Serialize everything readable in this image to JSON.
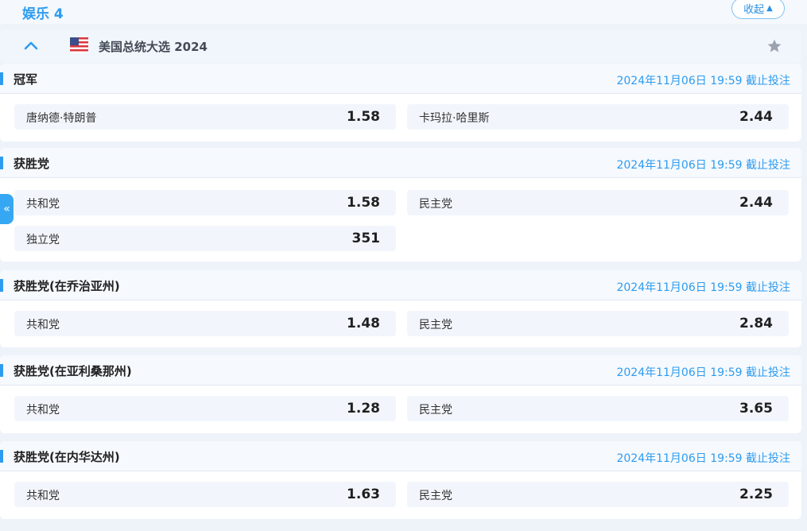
{
  "category": {
    "title": "娱乐 4",
    "collapse_label": "收起"
  },
  "event": {
    "name": "美国总统大选 2024"
  },
  "markets": [
    {
      "title": "冠军",
      "deadline": "2024年11月06日 19:59 截止投注",
      "selections": [
        {
          "name": "唐纳德·特朗普",
          "odds": "1.58"
        },
        {
          "name": "卡玛拉·哈里斯",
          "odds": "2.44"
        }
      ]
    },
    {
      "title": "获胜党",
      "deadline": "2024年11月06日 19:59 截止投注",
      "selections": [
        {
          "name": "共和党",
          "odds": "1.58"
        },
        {
          "name": "民主党",
          "odds": "2.44"
        },
        {
          "name": "独立党",
          "odds": "351"
        }
      ]
    },
    {
      "title": "获胜党(在乔治亚州)",
      "deadline": "2024年11月06日 19:59 截止投注",
      "selections": [
        {
          "name": "共和党",
          "odds": "1.48"
        },
        {
          "name": "民主党",
          "odds": "2.84"
        }
      ]
    },
    {
      "title": "获胜党(在亚利桑那州)",
      "deadline": "2024年11月06日 19:59 截止投注",
      "selections": [
        {
          "name": "共和党",
          "odds": "1.28"
        },
        {
          "name": "民主党",
          "odds": "3.65"
        }
      ]
    },
    {
      "title": "获胜党(在内华达州)",
      "deadline": "2024年11月06日 19:59 截止投注",
      "selections": [
        {
          "name": "共和党",
          "odds": "1.63"
        },
        {
          "name": "民主党",
          "odds": "2.25"
        }
      ]
    }
  ],
  "side_tab": {
    "label": "«"
  },
  "colors": {
    "accent": "#2d9cf0",
    "page_bg": "#eef3fa",
    "selection_bg": "#f2f6fc"
  },
  "icons": {
    "expand": "chevron-up-icon",
    "flag": "us-flag-icon",
    "favorite": "star-icon"
  }
}
